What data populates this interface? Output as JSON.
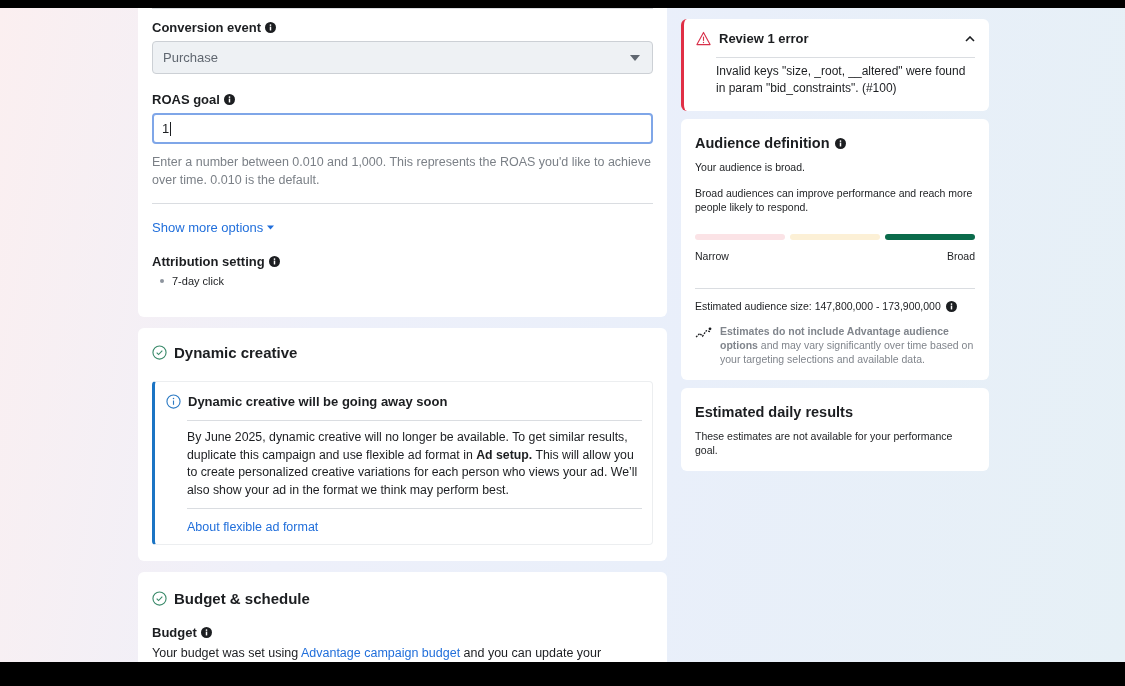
{
  "bid_section": {
    "conversion_event": {
      "label": "Conversion event",
      "value": "Purchase",
      "disabled": true
    },
    "roas_goal": {
      "label": "ROAS goal",
      "value": "1",
      "focused": true,
      "help": "Enter a number between 0.010 and 1,000. This represents the ROAS you'd like to achieve over time. 0.010 is the default."
    },
    "show_more": {
      "label": "Show more options",
      "expanded": false
    },
    "attribution": {
      "label": "Attribution setting",
      "items": [
        "7-day click"
      ]
    }
  },
  "dynamic_creative": {
    "title": "Dynamic creative",
    "complete": true,
    "notice": {
      "title": "Dynamic creative will be going away soon",
      "body": "By June 2025, dynamic creative will no longer be available. To get similar results, duplicate this campaign and use flexible ad format in **Ad setup.** This will allow you to create personalized creative variations for each person who views your ad. We’ll also show your ad in the format we think may perform best.",
      "link": "About flexible ad format"
    }
  },
  "budget_schedule": {
    "title": "Budget & schedule",
    "complete": true,
    "budget_label": "Budget",
    "text_before": "Your budget was set using",
    "link": "Advantage campaign budget",
    "text_after": "and you can update your"
  },
  "error_panel": {
    "title": "Review 1 error",
    "expanded": true,
    "message": "Invalid keys \"size, _root, __altered\" were found in param \"bid_constraints\". (#100)"
  },
  "audience_definition": {
    "title": "Audience definition",
    "summary": "Your audience is broad.",
    "description": "Broad audiences can improve performance and reach more people likely to respond.",
    "meter": [
      {
        "color": "#fbe3e6"
      },
      {
        "color": "#fcf0d6"
      },
      {
        "color": "#0b6b4b"
      }
    ],
    "low_label": "Narrow",
    "high_label": "Broad",
    "size": "Estimated audience size: 147,800,000 - 173,900,000",
    "note": "**Estimates do not include Advantage audience options** and may vary significantly over time based on your targeting selections and available data."
  },
  "daily_results": {
    "title": "Estimated daily results",
    "text": "These estimates are not available for your performance goal."
  }
}
